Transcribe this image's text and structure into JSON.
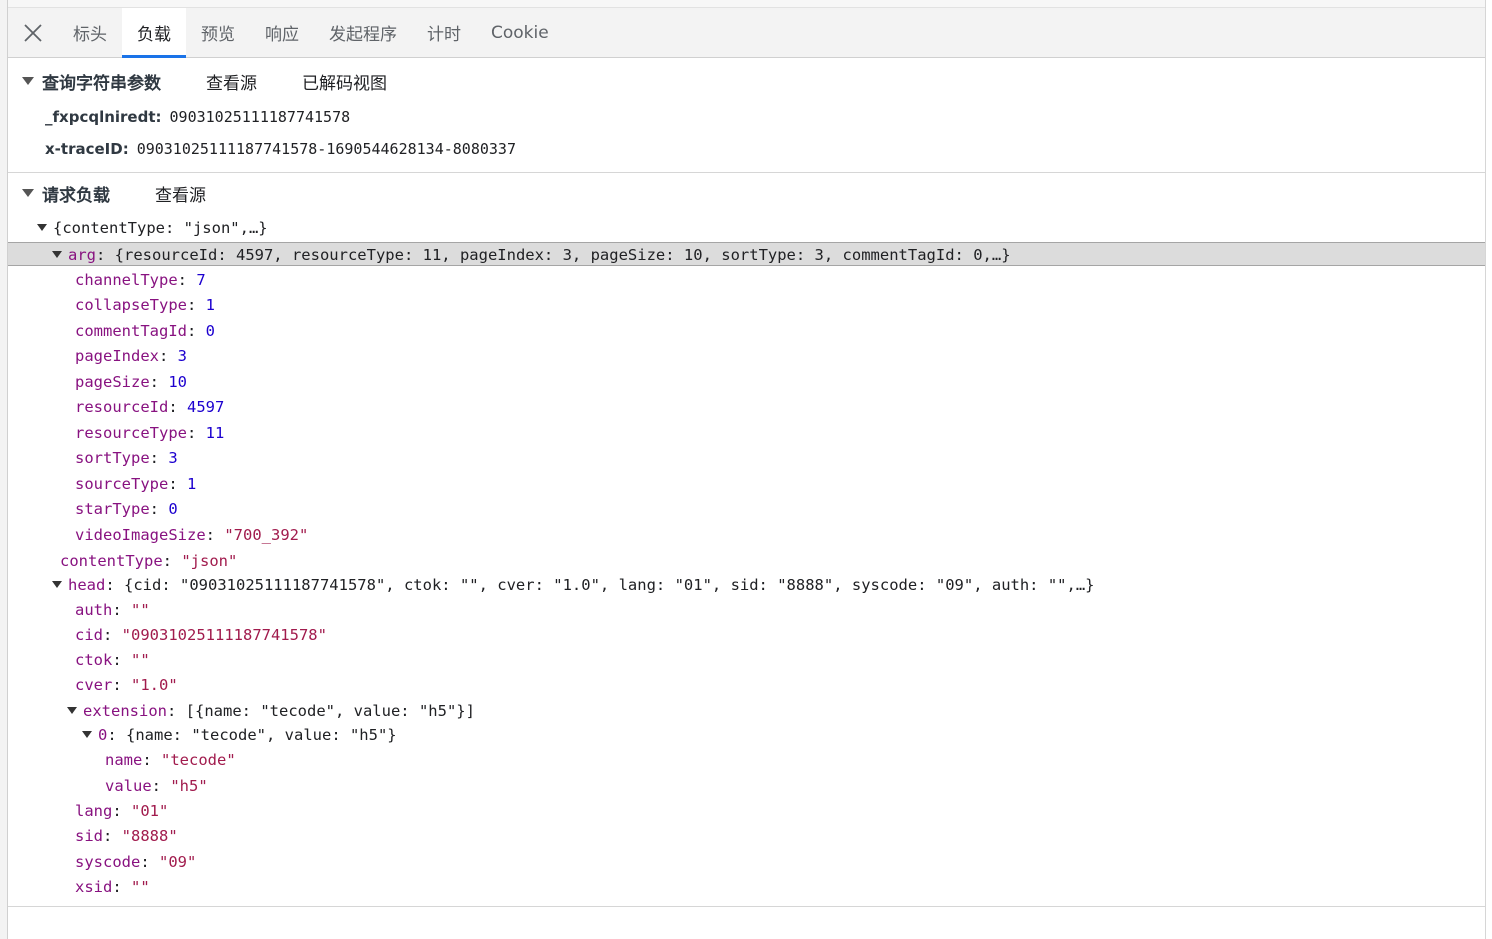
{
  "tabs": {
    "close_label": "✕",
    "items": [
      {
        "id": "headers",
        "label": "标头",
        "active": false
      },
      {
        "id": "payload",
        "label": "负载",
        "active": true
      },
      {
        "id": "preview",
        "label": "预览",
        "active": false
      },
      {
        "id": "response",
        "label": "响应",
        "active": false
      },
      {
        "id": "initiator",
        "label": "发起程序",
        "active": false
      },
      {
        "id": "timing",
        "label": "计时",
        "active": false
      },
      {
        "id": "cookie",
        "label": "Cookie",
        "active": false
      }
    ]
  },
  "query_section": {
    "title": "查询字符串参数",
    "view_source": "查看源",
    "view_decoded": "已解码视图",
    "params": [
      {
        "key": "_fxpcqlniredt:",
        "value": "09031025111187741578"
      },
      {
        "key": "x-traceID:",
        "value": "09031025111187741578-1690544628134-8080337"
      }
    ]
  },
  "payload_section": {
    "title": "请求负载",
    "view_source": "查看源"
  },
  "tree": {
    "root_summary": "{contentType: \"json\",…}",
    "arg": {
      "key": "arg",
      "summary": "{resourceId: 4597, resourceType: 11, pageIndex: 3, pageSize: 10, sortType: 3, commentTagId: 0,…}",
      "children": [
        {
          "key": "channelType",
          "value": "7",
          "type": "number"
        },
        {
          "key": "collapseType",
          "value": "1",
          "type": "number"
        },
        {
          "key": "commentTagId",
          "value": "0",
          "type": "number"
        },
        {
          "key": "pageIndex",
          "value": "3",
          "type": "number"
        },
        {
          "key": "pageSize",
          "value": "10",
          "type": "number"
        },
        {
          "key": "resourceId",
          "value": "4597",
          "type": "number"
        },
        {
          "key": "resourceType",
          "value": "11",
          "type": "number"
        },
        {
          "key": "sortType",
          "value": "3",
          "type": "number"
        },
        {
          "key": "sourceType",
          "value": "1",
          "type": "number"
        },
        {
          "key": "starType",
          "value": "0",
          "type": "number"
        },
        {
          "key": "videoImageSize",
          "value": "\"700_392\"",
          "type": "string"
        }
      ]
    },
    "contentType": {
      "key": "contentType",
      "value": "\"json\""
    },
    "head": {
      "key": "head",
      "summary": "{cid: \"09031025111187741578\", ctok: \"\", cver: \"1.0\", lang: \"01\", sid: \"8888\", syscode: \"09\", auth: \"\",…}",
      "children_before": [
        {
          "key": "auth",
          "value": "\"\""
        },
        {
          "key": "cid",
          "value": "\"09031025111187741578\""
        },
        {
          "key": "ctok",
          "value": "\"\""
        },
        {
          "key": "cver",
          "value": "\"1.0\""
        }
      ],
      "extension": {
        "key": "extension",
        "summary": "[{name: \"tecode\", value: \"h5\"}]",
        "item0": {
          "key": "0",
          "summary": "{name: \"tecode\", value: \"h5\"}",
          "name": {
            "key": "name",
            "value": "\"tecode\""
          },
          "value": {
            "key": "value",
            "value": "\"h5\""
          }
        }
      },
      "children_after": [
        {
          "key": "lang",
          "value": "\"01\""
        },
        {
          "key": "sid",
          "value": "\"8888\""
        },
        {
          "key": "syscode",
          "value": "\"09\""
        },
        {
          "key": "xsid",
          "value": "\"\""
        }
      ]
    }
  },
  "colors": {
    "key": "#881280",
    "number": "#1c00cf",
    "string": "#a11b4d",
    "active_tab_underline": "#1a73e8",
    "selected_row": "#dcdcdc"
  }
}
